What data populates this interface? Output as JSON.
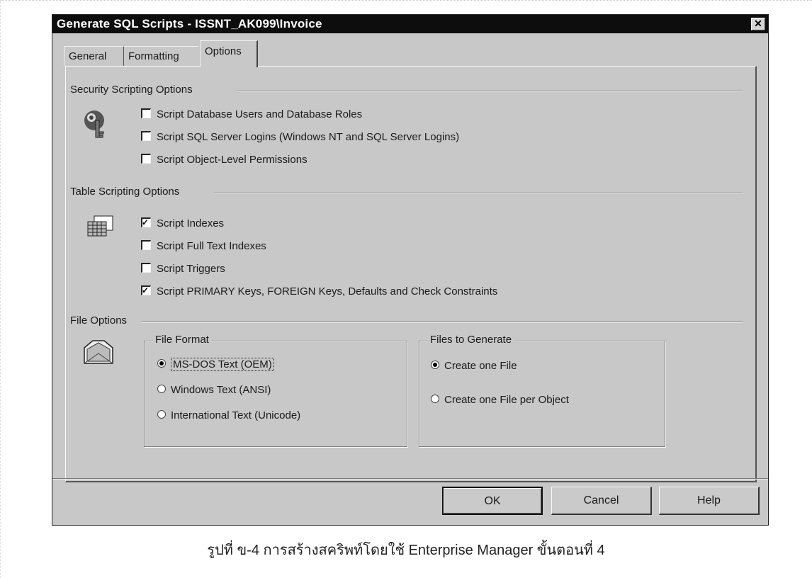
{
  "window": {
    "title": "Generate SQL Scripts - ISSNT_AK099\\Invoice",
    "close_glyph": "✕"
  },
  "tabs": [
    {
      "label": "General"
    },
    {
      "label": "Formatting"
    },
    {
      "label": "Options",
      "active": true
    }
  ],
  "security": {
    "title": "Security Scripting Options",
    "icon": "key-person-icon",
    "items": [
      {
        "label": "Script Database Users and Database Roles",
        "checked": false
      },
      {
        "label": "Script SQL Server Logins (Windows NT and SQL Server Logins)",
        "checked": false
      },
      {
        "label": "Script Object-Level Permissions",
        "checked": false
      }
    ]
  },
  "table": {
    "title": "Table Scripting Options",
    "icon": "table-grid-icon",
    "items": [
      {
        "label": "Script Indexes",
        "checked": true
      },
      {
        "label": "Script Full Text Indexes",
        "checked": false
      },
      {
        "label": "Script Triggers",
        "checked": false
      },
      {
        "label": "Script PRIMARY Keys, FOREIGN Keys, Defaults and Check Constraints",
        "checked": true
      }
    ]
  },
  "file": {
    "title": "File Options",
    "icon": "folder-file-icon",
    "format": {
      "title": "File Format",
      "options": [
        {
          "label": "MS-DOS Text (OEM)",
          "selected": true
        },
        {
          "label": "Windows Text (ANSI)",
          "selected": false
        },
        {
          "label": "International Text (Unicode)",
          "selected": false
        }
      ]
    },
    "generate": {
      "title": "Files to Generate",
      "options": [
        {
          "label": "Create one File",
          "selected": true
        },
        {
          "label": "Create one File per Object",
          "selected": false
        }
      ]
    }
  },
  "buttons": {
    "ok": "OK",
    "cancel": "Cancel",
    "help": "Help"
  },
  "caption": "รูปที่ ข-4 การสร้างสคริพท์โดยใช้ Enterprise Manager ขั้นตอนที่ 4"
}
